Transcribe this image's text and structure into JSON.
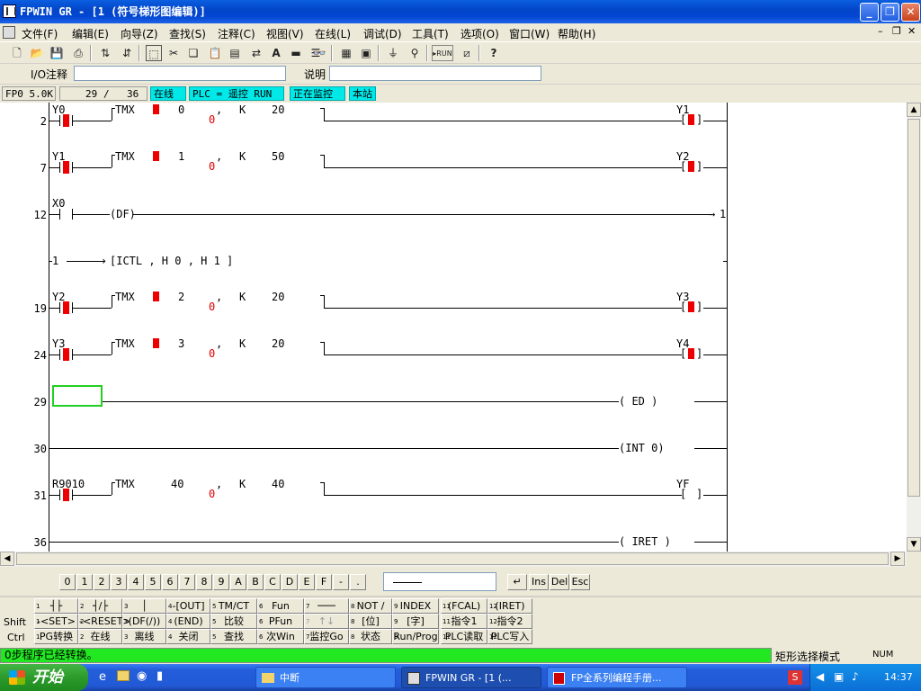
{
  "window": {
    "title": "FPWIN GR - [1 (符号梯形图编辑)]"
  },
  "menu": [
    "文件(F)",
    "编辑(E)",
    "向导(Z)",
    "查找(S)",
    "注释(C)",
    "视图(V)",
    "在线(L)",
    "调试(D)",
    "工具(T)",
    "选项(O)",
    "窗口(W)",
    "帮助(H)"
  ],
  "io_line": {
    "io_label": "I/O注释",
    "desc_label": "说明",
    "io_value": "",
    "desc_value": ""
  },
  "status": {
    "plc": "FP0 5.0K",
    "steps_cur": "29",
    "steps_sep": "/",
    "steps_total": "36",
    "online": "在线",
    "plc_mode": "PLC =  遥控 RUN",
    "monitor": "正在监控",
    "station": "本站"
  },
  "ladder": {
    "r2": {
      "n": "2",
      "contact": "Y0",
      "tmx": "TMX",
      "tno": "0",
      "k": "K",
      "kv": "20",
      "coil": "Y1",
      "sub": "0",
      "comma": ","
    },
    "r7": {
      "n": "7",
      "contact": "Y1",
      "tmx": "TMX",
      "tno": "1",
      "k": "K",
      "kv": "50",
      "coil": "Y2",
      "sub": "0",
      "comma": ","
    },
    "r12": {
      "n": "12",
      "contact": "X0",
      "df": "(DF)",
      "jump": "1"
    },
    "ictl": {
      "lead": "1",
      "text": "[ICTL    ,   H 0          ,    H 1           ]"
    },
    "r19": {
      "n": "19",
      "contact": "Y2",
      "tmx": "TMX",
      "tno": "2",
      "k": "K",
      "kv": "20",
      "coil": "Y3",
      "sub": "0",
      "comma": ","
    },
    "r24": {
      "n": "24",
      "contact": "Y3",
      "tmx": "TMX",
      "tno": "3",
      "k": "K",
      "kv": "20",
      "coil": "Y4",
      "sub": "0",
      "comma": ","
    },
    "r29": {
      "n": "29",
      "out": "(    ED     )"
    },
    "r30": {
      "n": "30",
      "out": "(INT      0)"
    },
    "r31": {
      "n": "31",
      "contact": "R9010",
      "tmx": "TMX",
      "tno": "40",
      "k": "K",
      "kv": "40",
      "coil": "YF",
      "sub": "0",
      "comma": ","
    },
    "r36": {
      "n": "36",
      "out": "(   IRET    )"
    }
  },
  "keys": [
    "0",
    "1",
    "2",
    "3",
    "4",
    "5",
    "6",
    "7",
    "8",
    "9",
    "A",
    "B",
    "C",
    "D",
    "E",
    "F",
    "-",
    "."
  ],
  "edit_keys": [
    "Ins",
    "Del",
    "Esc"
  ],
  "fkeys": {
    "row1": [
      "┤├",
      "┤/├",
      "│",
      "-[OUT]",
      "TM/CT",
      "Fun",
      "───",
      "NOT /",
      "INDEX",
      "(FCAL)",
      "(IRET)"
    ],
    "row2_label": "Shift",
    "row2": [
      "-<SET>",
      "-<RESET>",
      "(DF(/))",
      "(END)",
      "比较",
      "PFun",
      "↑↓",
      "[位]",
      "[字]",
      "指令1",
      "指令2"
    ],
    "row3_label": "Ctrl",
    "row3": [
      "PG转换",
      "在线",
      "离线",
      "关闭",
      "查找",
      "次Win",
      "监控Go",
      "状态",
      "Run/Prog",
      "PLC读取",
      "PLC写入"
    ]
  },
  "message": "0步程序已经转换。",
  "mode_text": "矩形选择模式",
  "num": "NUM",
  "taskbar": {
    "start": "开始",
    "tasks": [
      "中断",
      "FPWIN GR - [1 (...",
      "FP全系列编程手册..."
    ],
    "clock": "14:37"
  }
}
